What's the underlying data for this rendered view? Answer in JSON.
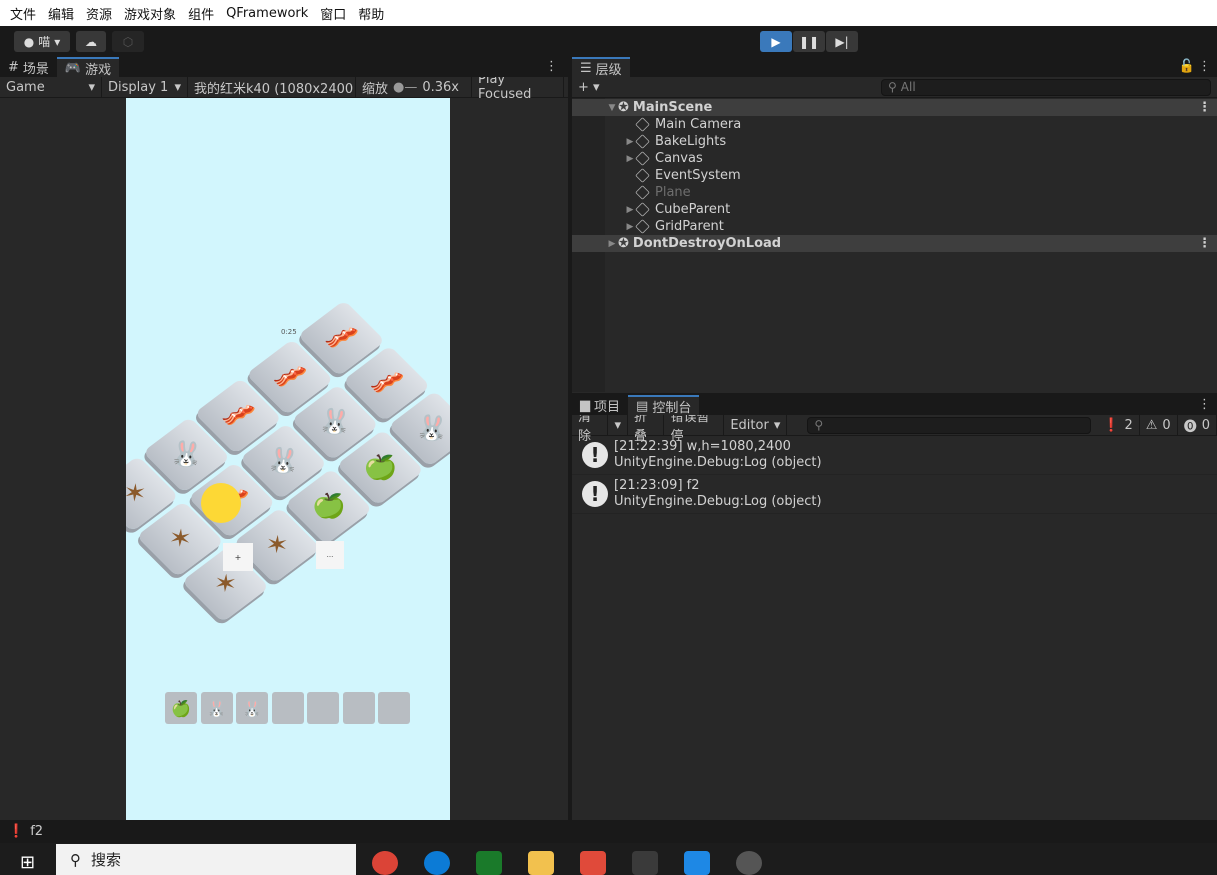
{
  "menu": [
    "文件",
    "编辑",
    "资源",
    "游戏对象",
    "组件",
    "QFramework",
    "窗口",
    "帮助"
  ],
  "toolbar": {
    "account": "喵",
    "account_icon": "user-icon",
    "cloud_icon": "cloud-icon",
    "collab_icon": "collab-icon",
    "play_icon": "play-icon",
    "pause_icon": "pause-icon",
    "step_icon": "step-icon",
    "play_color": "#3a79bb"
  },
  "left": {
    "tabs": [
      {
        "label": "场景",
        "icon": "grid-icon"
      },
      {
        "label": "游戏",
        "icon": "gamepad-icon",
        "active": true
      }
    ],
    "game_dropdown": "Game",
    "display_dropdown": "Display 1",
    "resolution_dropdown": "我的红米k40 (1080x2400",
    "scale_label": "缩放",
    "scale_value": "0.36x",
    "play_focused": "Play Focused"
  },
  "game": {
    "bg_color": "#d2f6fd",
    "timer": "0:25",
    "button_left": "+",
    "button_right": "...",
    "tiles": [
      "bacon",
      "bacon",
      "rabbit",
      "bacon",
      "rabbit",
      "apple",
      "bacon",
      "rabbit",
      "apple",
      "rabbit",
      "bacon",
      "star",
      "star",
      "star",
      "star"
    ],
    "slots": [
      "apple",
      "rabbit",
      "rabbit",
      "",
      "",
      "",
      ""
    ]
  },
  "hierarchy": {
    "tab": "层级",
    "search_placeholder": "All",
    "items": [
      {
        "label": "MainScene",
        "type": "scene",
        "expanded": true
      },
      {
        "label": "Main Camera"
      },
      {
        "label": "BakeLights",
        "arrow": true
      },
      {
        "label": "Canvas",
        "arrow": true
      },
      {
        "label": "EventSystem"
      },
      {
        "label": "Plane",
        "disabled": true
      },
      {
        "label": "CubeParent",
        "arrow": true
      },
      {
        "label": "GridParent",
        "arrow": true
      },
      {
        "label": "DontDestroyOnLoad",
        "type": "scene"
      }
    ]
  },
  "console": {
    "tabs": [
      {
        "label": "项目",
        "icon": "folder-icon"
      },
      {
        "label": "控制台",
        "icon": "console-icon",
        "active": true
      }
    ],
    "clear": "清除",
    "collapse": "折叠",
    "error_pause": "错误暂停",
    "editor": "Editor",
    "counts": {
      "info": "2",
      "warning": "0",
      "error": "0"
    },
    "logs": [
      {
        "line1": "[21:22:39] w,h=1080,2400",
        "line2": "UnityEngine.Debug:Log (object)"
      },
      {
        "line1": "[21:23:09] f2",
        "line2": "UnityEngine.Debug:Log (object)"
      }
    ]
  },
  "status": {
    "text": "f2"
  },
  "taskbar": {
    "search": "搜索",
    "apps": [
      "chrome",
      "edge",
      "ime",
      "file-explorer",
      "cat-app",
      "unity",
      "vscode",
      "recorder"
    ]
  }
}
